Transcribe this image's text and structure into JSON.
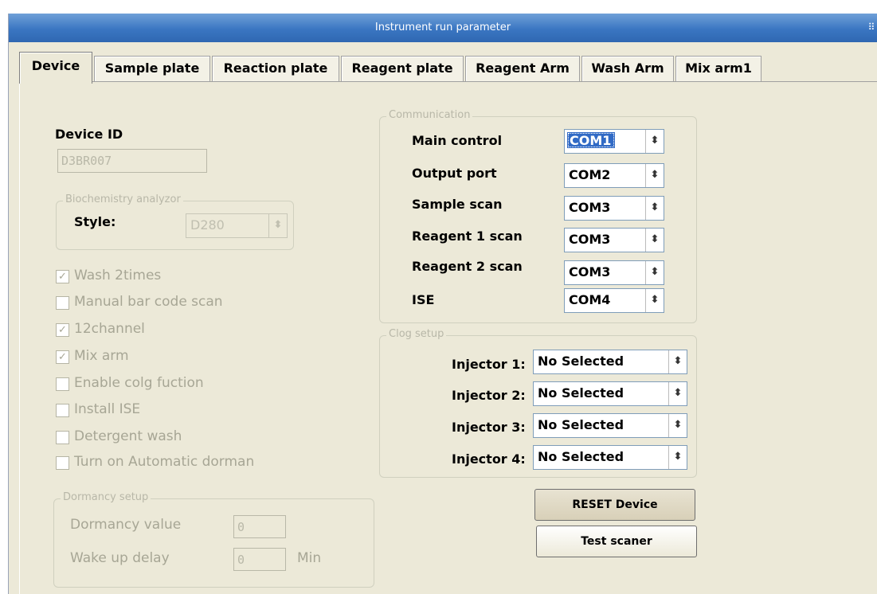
{
  "window": {
    "title": "Instrument run parameter"
  },
  "tabs": [
    {
      "label": "Device"
    },
    {
      "label": "Sample plate"
    },
    {
      "label": "Reaction plate"
    },
    {
      "label": "Reagent plate"
    },
    {
      "label": "Reagent Arm"
    },
    {
      "label": "Wash Arm"
    },
    {
      "label": "Mix arm1"
    }
  ],
  "device": {
    "id_label": "Device ID",
    "id_value": "D3BR007",
    "biochem_group": "Biochemistry analyzor",
    "style_label": "Style:",
    "style_value": "D280"
  },
  "options": [
    {
      "label": "Wash 2times",
      "checked": true
    },
    {
      "label": "Manual bar code scan",
      "checked": false
    },
    {
      "label": "12channel",
      "checked": true
    },
    {
      "label": "Mix arm",
      "checked": true
    },
    {
      "label": "Enable colg fuction",
      "checked": false
    },
    {
      "label": "Install ISE",
      "checked": false
    },
    {
      "label": "Detergent wash",
      "checked": false
    },
    {
      "label": "Turn on Automatic dorman",
      "checked": false
    }
  ],
  "dormancy": {
    "group_title": "Dormancy setup",
    "value_label": "Dormancy value",
    "value": "0",
    "wake_label": "Wake up delay",
    "wake_value": "0",
    "wake_unit": "Min"
  },
  "communication": {
    "group_title": "Communication",
    "ports": [
      {
        "label": "Main control",
        "value": "COM1"
      },
      {
        "label": "Output port",
        "value": "COM2"
      },
      {
        "label": "Sample scan",
        "value": "COM3"
      },
      {
        "label": "Reagent 1 scan",
        "value": "COM3"
      },
      {
        "label": "Reagent 2 scan",
        "value": "COM3"
      },
      {
        "label": "ISE",
        "value": "COM4"
      }
    ]
  },
  "clog": {
    "group_title": "Clog setup",
    "injectors": [
      {
        "label": "Injector 1:",
        "value": "No Selected"
      },
      {
        "label": "Injector 2:",
        "value": "No Selected"
      },
      {
        "label": "Injector 3:",
        "value": "No Selected"
      },
      {
        "label": "Injector 4:",
        "value": "No Selected"
      }
    ]
  },
  "buttons": {
    "reset": "RESET Device",
    "test": "Test scaner"
  },
  "icons": {
    "spin": "⬍",
    "check": "✓",
    "grip": "⠿"
  },
  "colors": {
    "titlebar": "#3a76c2",
    "face": "#ece9d8",
    "highlight": "#316ac5"
  }
}
